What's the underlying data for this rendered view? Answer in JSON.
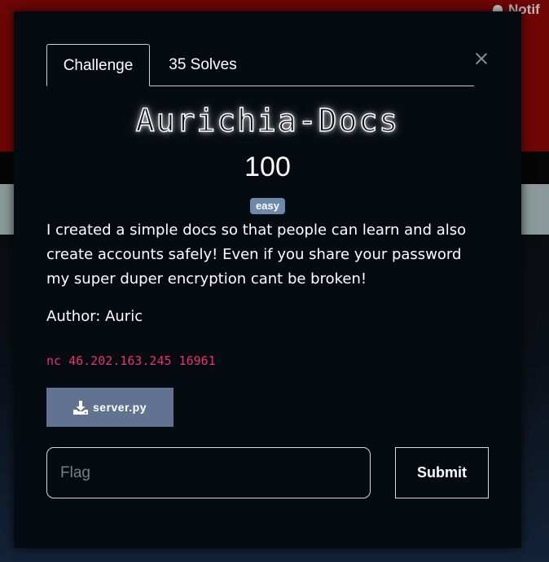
{
  "navbar": {
    "notifications_label": "Notif"
  },
  "modal": {
    "tabs": [
      {
        "label": "Challenge"
      },
      {
        "label": "35 Solves"
      }
    ],
    "challenge": {
      "title": "Aurichia-Docs",
      "points": "100",
      "difficulty": "easy",
      "description": "I created a simple docs so that people can learn and also create accounts safely! Even if you share your password my super duper encryption cant be broken!",
      "author": "Author: Auric",
      "connection": "nc 46.202.163.245 16961",
      "file": "server.py"
    },
    "form": {
      "flag_placeholder": "Flag",
      "flag_value": "",
      "submit_label": "Submit"
    }
  },
  "colors": {
    "header_red": "#6e0606",
    "badge": "#6d8aaa",
    "file_button": "#627391",
    "connection_text": "#e6336c"
  }
}
